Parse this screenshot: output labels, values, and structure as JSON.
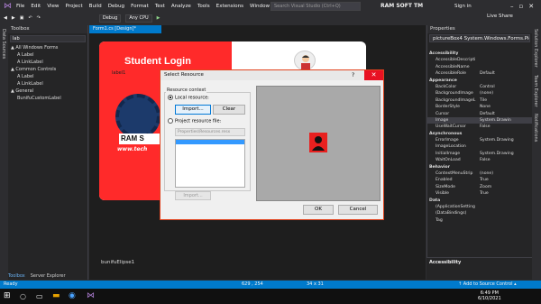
{
  "menubar": {
    "items": [
      "File",
      "Edit",
      "View",
      "Project",
      "Build",
      "Debug",
      "Format",
      "Test",
      "Analyze",
      "Tools",
      "Extensions",
      "Window",
      "Help"
    ],
    "search_placeholder": "Search Visual Studio (Ctrl+Q)",
    "solution_name": "RAM SOFT TM",
    "sign_in": "Sign in"
  },
  "toolbar": {
    "config": "Debug",
    "platform": "Any CPU",
    "live_share": "Live Share"
  },
  "toolbox": {
    "title": "Toolbox",
    "search": "lab",
    "items": [
      {
        "label": "▲ All Windows Forms",
        "indent": 0
      },
      {
        "label": "A  Label",
        "indent": 1
      },
      {
        "label": "A  LinkLabel",
        "indent": 1
      },
      {
        "label": "▲ Common Controls",
        "indent": 0
      },
      {
        "label": "A  Label",
        "indent": 1
      },
      {
        "label": "A  LinkLabel",
        "indent": 1
      },
      {
        "label": "▲ General",
        "indent": 0
      },
      {
        "label": "   BunifuCustomLabel",
        "indent": 1
      }
    ],
    "tabs": [
      "Toolbox",
      "Server Explorer"
    ]
  },
  "sidetabs": {
    "left": "Data Sources"
  },
  "document": {
    "tab": "Form1.cs [Design]*",
    "form_title": "Student Login",
    "label1": "label1",
    "brand": "RAM S",
    "url": "www.tech",
    "component_tray": "bunifuElipse1"
  },
  "dialog": {
    "title": "Select Resource",
    "help": "?",
    "close": "✕",
    "resource_context": "Resource context",
    "local_resource": "Local resource:",
    "import": "Import...",
    "clear": "Clear",
    "project_resource": "Project resource file:",
    "resource_file": "Properties\\Resources.resx",
    "import2": "Import...",
    "ok": "OK",
    "cancel": "Cancel"
  },
  "properties": {
    "title": "Properties",
    "selected": "pictureBox4  System.Windows.Forms.Pictur",
    "rows": [
      {
        "n": "Accessibility",
        "v": "",
        "cat": true
      },
      {
        "n": "AccessibleDescripti",
        "v": ""
      },
      {
        "n": "AccessibleName",
        "v": ""
      },
      {
        "n": "AccessibleRole",
        "v": "Default"
      },
      {
        "n": "Appearance",
        "v": "",
        "cat": true
      },
      {
        "n": "BackColor",
        "v": "Control"
      },
      {
        "n": "BackgroundImage",
        "v": "(none)"
      },
      {
        "n": "BackgroundImageL",
        "v": "Tile"
      },
      {
        "n": "BorderStyle",
        "v": "None"
      },
      {
        "n": "Cursor",
        "v": "Default"
      },
      {
        "n": "Image",
        "v": "System.Drawin",
        "hl": true
      },
      {
        "n": "UseWaitCursor",
        "v": "False"
      },
      {
        "n": "Asynchronous",
        "v": "",
        "cat": true
      },
      {
        "n": "ErrorImage",
        "v": "System.Drawing"
      },
      {
        "n": "ImageLocation",
        "v": ""
      },
      {
        "n": "InitialImage",
        "v": "System.Drawing"
      },
      {
        "n": "WaitOnLoad",
        "v": "False"
      },
      {
        "n": "Behavior",
        "v": "",
        "cat": true
      },
      {
        "n": "ContextMenuStrip",
        "v": "(none)"
      },
      {
        "n": "Enabled",
        "v": "True"
      },
      {
        "n": "SizeMode",
        "v": "Zoom"
      },
      {
        "n": "Visible",
        "v": "True"
      },
      {
        "n": "Data",
        "v": "",
        "cat": true
      },
      {
        "n": "(ApplicationSetting",
        "v": ""
      },
      {
        "n": "(DataBindings)",
        "v": ""
      },
      {
        "n": "Tag",
        "v": ""
      }
    ],
    "description": "Accessibility"
  },
  "righttabs": [
    "Solution Explorer",
    "Team Explorer",
    "Notifications"
  ],
  "status": {
    "ready": "Ready",
    "position": "629 , 254",
    "size": "34 x 31",
    "source_control": "↑ Add to Source Control ▴"
  },
  "taskbar": {
    "time": "6:49 PM",
    "date": "6/10/2021"
  }
}
